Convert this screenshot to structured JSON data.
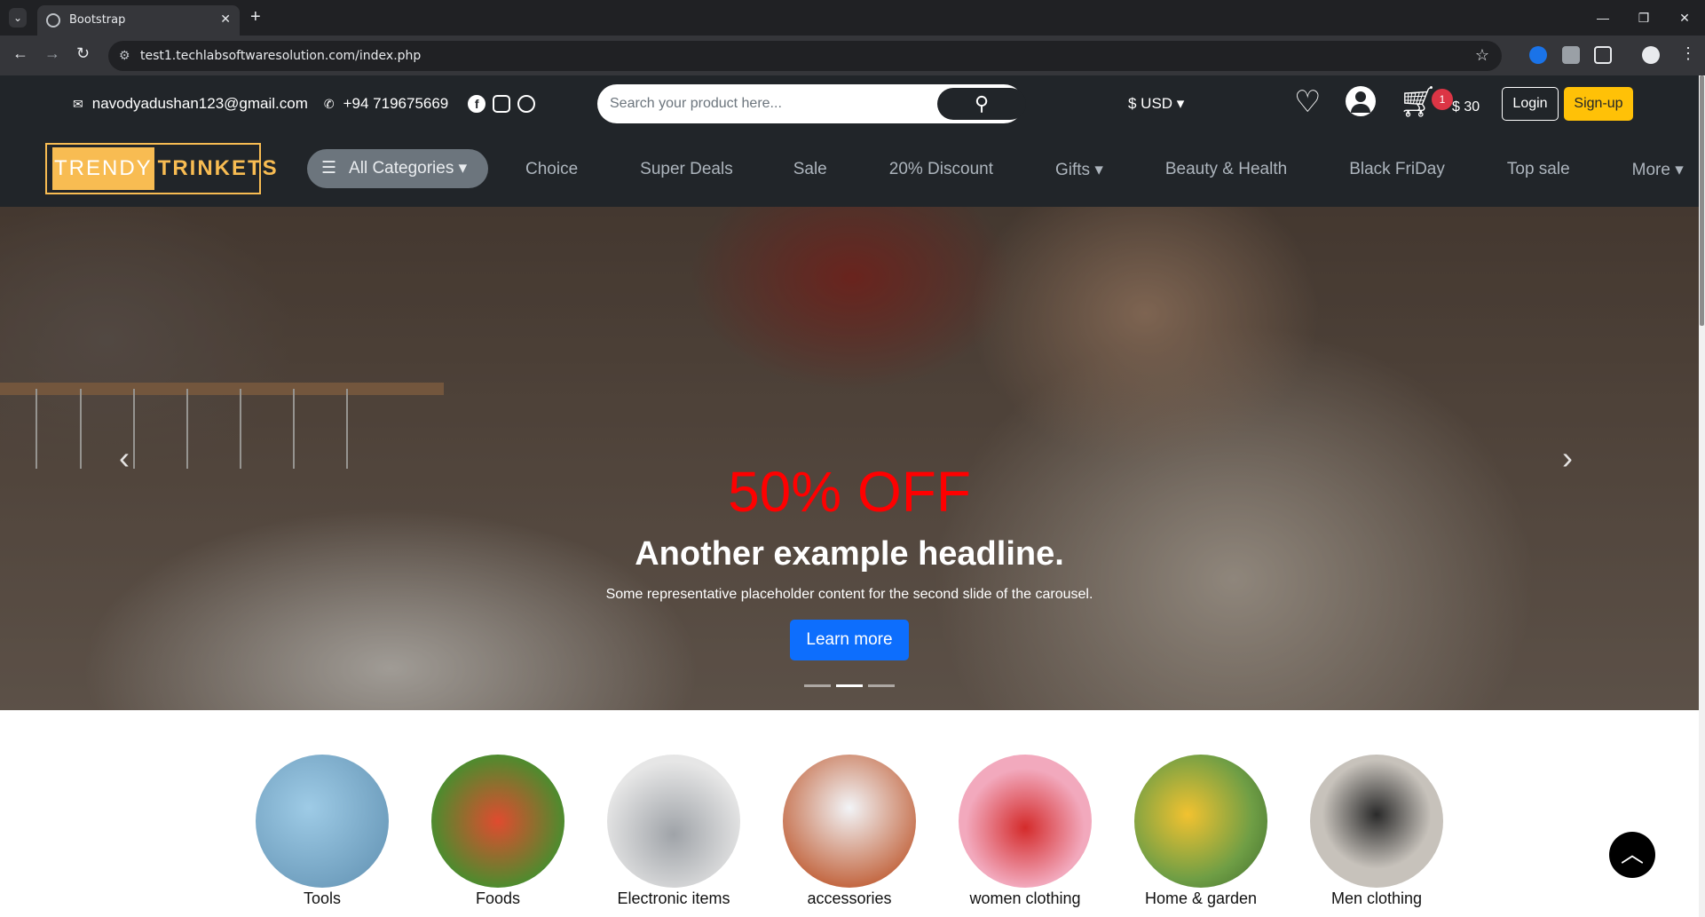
{
  "browser": {
    "tab_title": "Bootstrap",
    "url": "test1.techlabsoftwaresolution.com/index.php",
    "icons": [
      "tab-search-icon",
      "globe-icon",
      "close-icon",
      "plus-icon",
      "back-icon",
      "forward-icon",
      "reload-icon",
      "site-info-icon",
      "star-icon",
      "extensions-icon",
      "profile-icon",
      "kebab-icon"
    ]
  },
  "topbar": {
    "email": "navodyadushan123@gmail.com",
    "phone": "+94 719675669",
    "search_placeholder": "Search your product here...",
    "currency": "$ USD",
    "cart_count": "1",
    "cart_total": "$ 30",
    "login": "Login",
    "signup": "Sign-up"
  },
  "logo": {
    "part1": "TRENDY",
    "part2": "TRINKETS"
  },
  "nav": {
    "all_categories": "All Categories",
    "items": [
      "Choice",
      "Super Deals",
      "Sale",
      "20% Discount",
      "Gifts",
      "Beauty & Health",
      "Black FriDay",
      "Top sale",
      "More"
    ]
  },
  "hero": {
    "discount": "50% OFF",
    "headline": "Another example headline.",
    "subtext": "Some representative placeholder content for the second slide of the carousel.",
    "cta": "Learn more",
    "active_slide_index": 1,
    "slide_count": 3
  },
  "categories": [
    "Tools",
    "Foods",
    "Electronic items",
    "accessories",
    "women clothing",
    "Home & garden",
    "Men clothing"
  ],
  "colors": {
    "header_bg": "#212529",
    "accent_yellow": "#ffc107",
    "logo_gold": "#f8bc52",
    "cta_blue": "#0d6efd",
    "discount_red": "#ff0000",
    "badge_red": "#dc3545"
  }
}
